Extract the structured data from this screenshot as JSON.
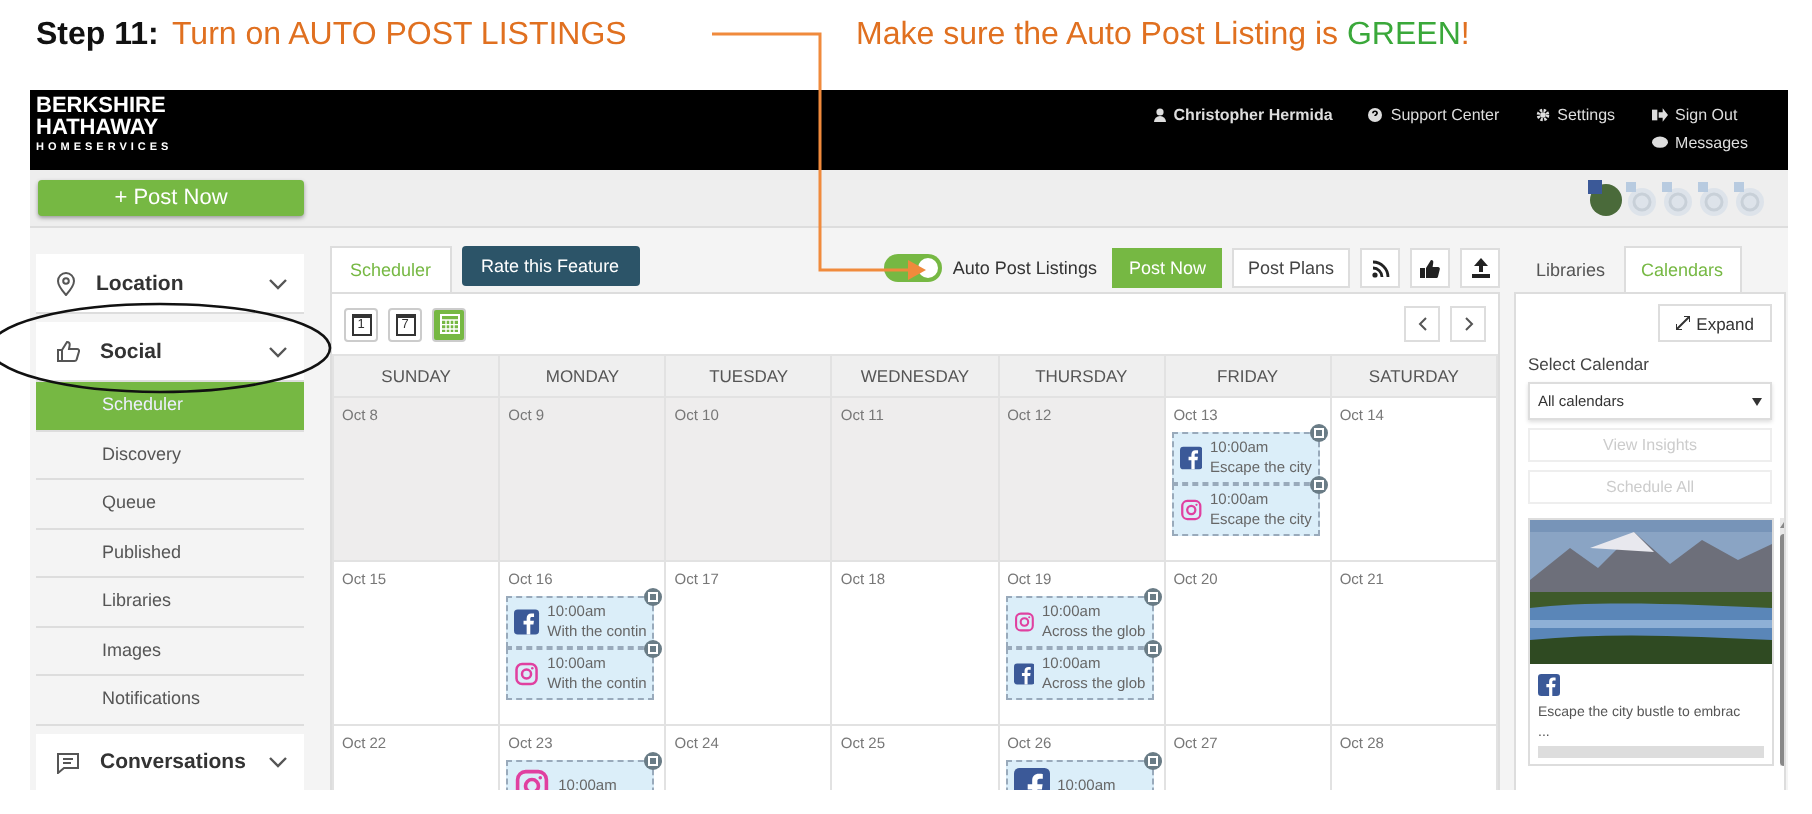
{
  "annotation": {
    "step": "Step 11:",
    "instruction": "Turn on AUTO POST LISTINGS",
    "note": [
      {
        "text": "Make sure the Auto Post Listing is ",
        "highlight": false
      },
      {
        "text": "GREEN",
        "highlight": true
      },
      {
        "text": "!",
        "highlight": false
      }
    ]
  },
  "header": {
    "logo": [
      "BERKSHIRE",
      "HATHAWAY",
      "HOMESERVICES"
    ],
    "user": "Christopher Hermida",
    "links": [
      {
        "kind": "help",
        "label": "Support Center"
      },
      {
        "kind": "settings",
        "label": "Settings"
      },
      {
        "kind": "signout",
        "label": "Sign Out"
      }
    ],
    "messages": "Messages"
  },
  "post_button": "+ Post Now",
  "sidebar": [
    {
      "kind": "location",
      "label": "Location"
    },
    {
      "kind": "social",
      "label": "Social",
      "children": [
        {
          "label": "Scheduler",
          "selected": true
        },
        {
          "label": "Discovery",
          "selected": false
        },
        {
          "label": "Queue",
          "selected": false
        },
        {
          "label": "Published",
          "selected": false
        },
        {
          "label": "Libraries",
          "selected": false
        },
        {
          "label": "Images",
          "selected": false
        },
        {
          "label": "Notifications",
          "selected": false
        }
      ]
    },
    {
      "kind": "conversations",
      "label": "Conversations"
    }
  ],
  "scheduler": {
    "tabs": [
      {
        "label": "Scheduler",
        "selected": true
      }
    ],
    "rate_button": "Rate this Feature",
    "auto_post": {
      "label": "Auto Post Listings",
      "on": true
    },
    "buttons": [
      "Post Now",
      "Post Plans"
    ],
    "views": [
      {
        "kind": "day",
        "label": "1",
        "selected": false
      },
      {
        "kind": "week",
        "label": "7",
        "selected": false
      },
      {
        "kind": "month",
        "selected": true
      }
    ],
    "days": [
      "SUNDAY",
      "MONDAY",
      "TUESDAY",
      "WEDNESDAY",
      "THURSDAY",
      "FRIDAY",
      "SATURDAY"
    ],
    "weeks": [
      [
        {
          "date": "Oct 8",
          "past": true
        },
        {
          "date": "Oct 9",
          "past": true
        },
        {
          "date": "Oct 10",
          "past": true
        },
        {
          "date": "Oct 11",
          "past": true
        },
        {
          "date": "Oct 12",
          "past": true
        },
        {
          "date": "Oct 13",
          "past": false,
          "events": [
            {
              "kind": "facebook",
              "time": "10:00am",
              "text": "Escape the city"
            },
            {
              "kind": "instagram",
              "time": "10:00am",
              "text": "Escape the city"
            }
          ]
        },
        {
          "date": "Oct 14",
          "past": false
        }
      ],
      [
        {
          "date": "Oct 15",
          "past": false
        },
        {
          "date": "Oct 16",
          "past": false,
          "events": [
            {
              "kind": "facebook",
              "time": "10:00am",
              "text": "With the contin"
            },
            {
              "kind": "instagram",
              "time": "10:00am",
              "text": "With the contin"
            }
          ]
        },
        {
          "date": "Oct 17",
          "past": false
        },
        {
          "date": "Oct 18",
          "past": false
        },
        {
          "date": "Oct 19",
          "past": false,
          "events": [
            {
              "kind": "instagram",
              "time": "10:00am",
              "text": "Across the glob"
            },
            {
              "kind": "facebook",
              "time": "10:00am",
              "text": "Across the glob"
            }
          ]
        },
        {
          "date": "Oct 20",
          "past": false
        },
        {
          "date": "Oct 21",
          "past": false
        }
      ],
      [
        {
          "date": "Oct 22",
          "past": false
        },
        {
          "date": "Oct 23",
          "past": false,
          "events": [
            {
              "kind": "instagram",
              "time": "10:00am"
            }
          ]
        },
        {
          "date": "Oct 24",
          "past": false
        },
        {
          "date": "Oct 25",
          "past": false
        },
        {
          "date": "Oct 26",
          "past": false,
          "events": [
            {
              "kind": "facebook",
              "time": "10:00am"
            }
          ]
        },
        {
          "date": "Oct 27",
          "past": false
        },
        {
          "date": "Oct 28",
          "past": false
        }
      ]
    ]
  },
  "right_panel": {
    "tabs": [
      {
        "label": "Libraries",
        "selected": false
      },
      {
        "label": "Calendars",
        "selected": true
      }
    ],
    "expand_button": "Expand",
    "select_label": "Select Calendar",
    "select_value": "All calendars",
    "buttons": [
      {
        "label": "View Insights",
        "disabled": true
      },
      {
        "label": "Schedule All",
        "disabled": true
      }
    ],
    "card": {
      "kind": "facebook",
      "text": "Escape the city bustle to embrac",
      "more": "..."
    }
  }
}
